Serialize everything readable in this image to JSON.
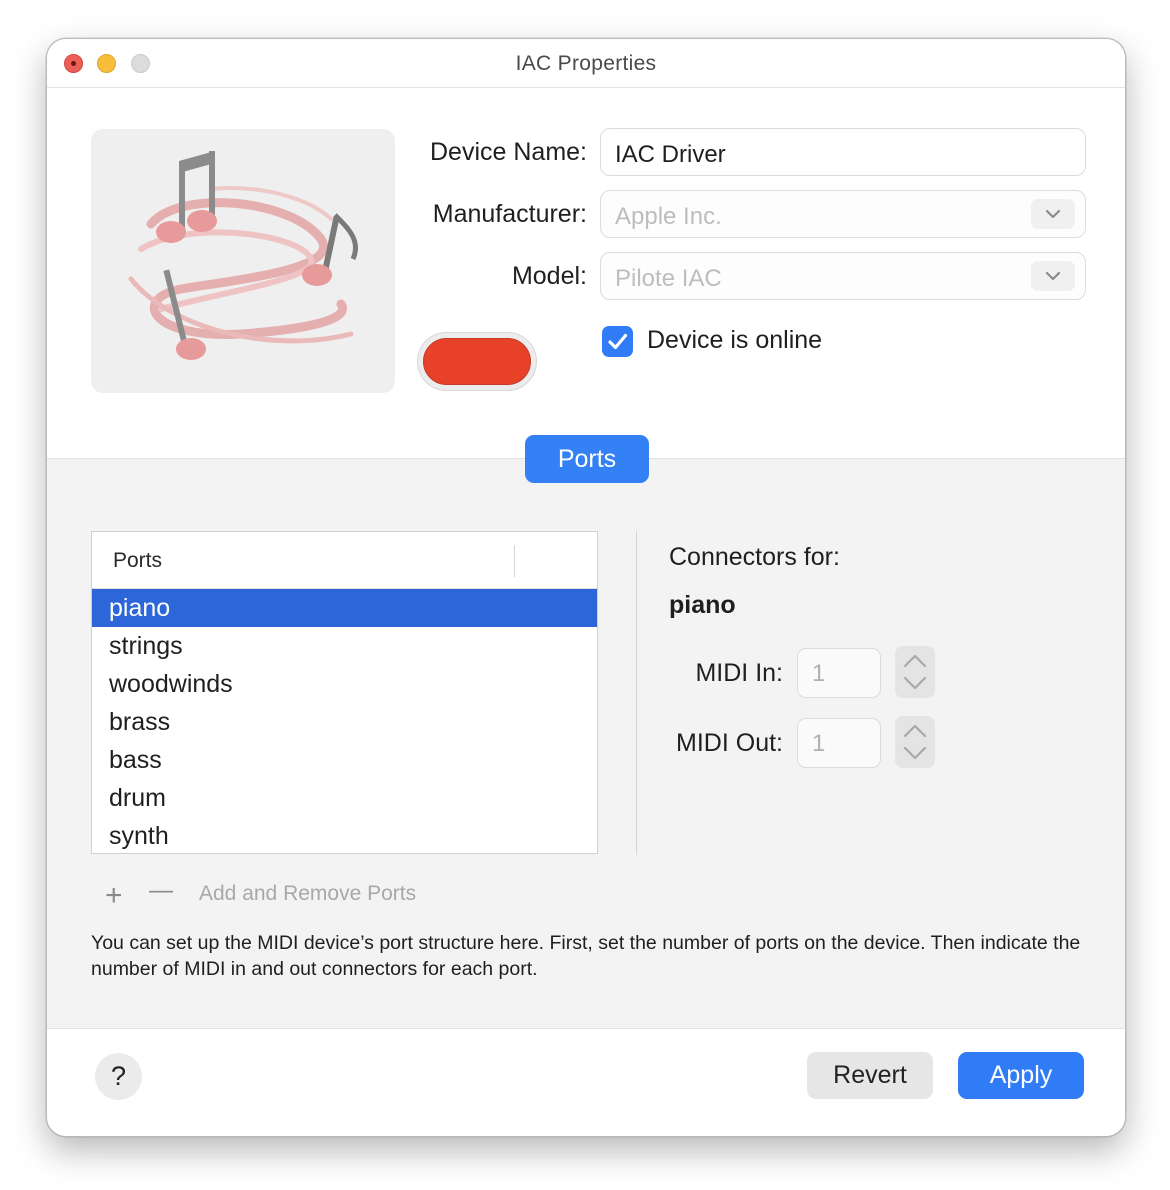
{
  "window": {
    "title": "IAC Properties"
  },
  "device": {
    "name_label": "Device Name:",
    "name_value": "IAC Driver",
    "manufacturer_label": "Manufacturer:",
    "manufacturer_value": "Apple Inc.",
    "model_label": "Model:",
    "model_value": "Pilote IAC",
    "online_label": "Device is online",
    "online_checked": true,
    "color": "#e8412a",
    "icon": "music-notes-icon"
  },
  "tabs": {
    "ports_label": "Ports"
  },
  "ports": {
    "header": "Ports",
    "items": [
      "piano",
      "strings",
      "woodwinds",
      "brass",
      "bass",
      "drum",
      "synth"
    ],
    "selected": "piano"
  },
  "connectors": {
    "title": "Connectors for:",
    "port_name": "piano",
    "midi_in_label": "MIDI In:",
    "midi_in_value": "1",
    "midi_out_label": "MIDI Out:",
    "midi_out_value": "1"
  },
  "port_controls": {
    "add_symbol": "+",
    "remove_symbol": "—",
    "label": "Add and Remove Ports"
  },
  "help_text": "You can set up the MIDI device’s port structure here. First, set the number of ports on the device. Then indicate the number of MIDI in and out connectors for each port.",
  "footer": {
    "help_symbol": "?",
    "revert_label": "Revert",
    "apply_label": "Apply"
  },
  "colors": {
    "accent": "#2f7cf6",
    "selection": "#2d66d8"
  }
}
